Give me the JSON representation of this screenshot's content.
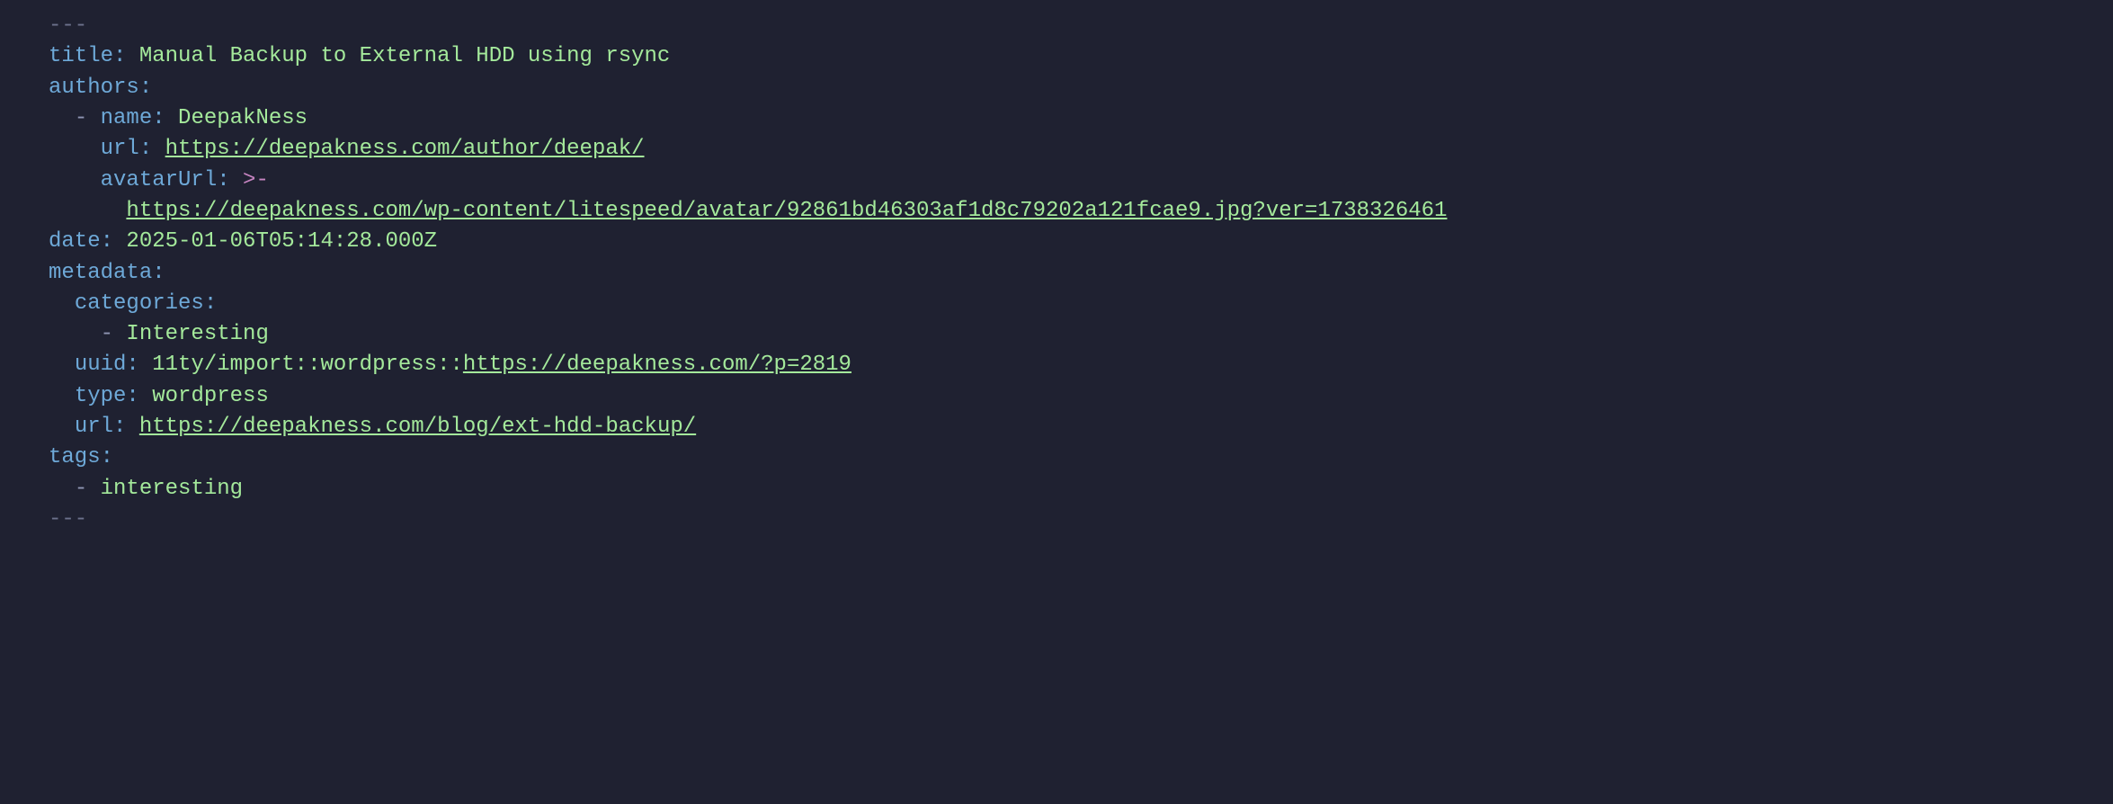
{
  "frontmatter": {
    "open": "---",
    "close": "---"
  },
  "title_key": "title",
  "title_value": "Manual Backup to External HDD using rsync",
  "authors_key": "authors",
  "author": {
    "name_key": "name",
    "name_value": "DeepakNess",
    "url_key": "url",
    "url_value": "https://deepakness.com/author/deepak/",
    "avatar_key": "avatarUrl",
    "avatar_fold": ">-",
    "avatar_value": "https://deepakness.com/wp-content/litespeed/avatar/92861bd46303af1d8c79202a121fcae9.jpg?ver=1738326461"
  },
  "date_key": "date",
  "date_value": "2025-01-06T05:14:28.000Z",
  "metadata_key": "metadata",
  "categories_key": "categories",
  "category_value": "Interesting",
  "uuid_key": "uuid",
  "uuid_prefix": "11ty/import::wordpress::",
  "uuid_link": "https://deepakness.com/?p=2819",
  "type_key": "type",
  "type_value": "wordpress",
  "meta_url_key": "url",
  "meta_url_value": "https://deepakness.com/blog/ext-hdd-backup/",
  "tags_key": "tags",
  "tag_value": "interesting"
}
